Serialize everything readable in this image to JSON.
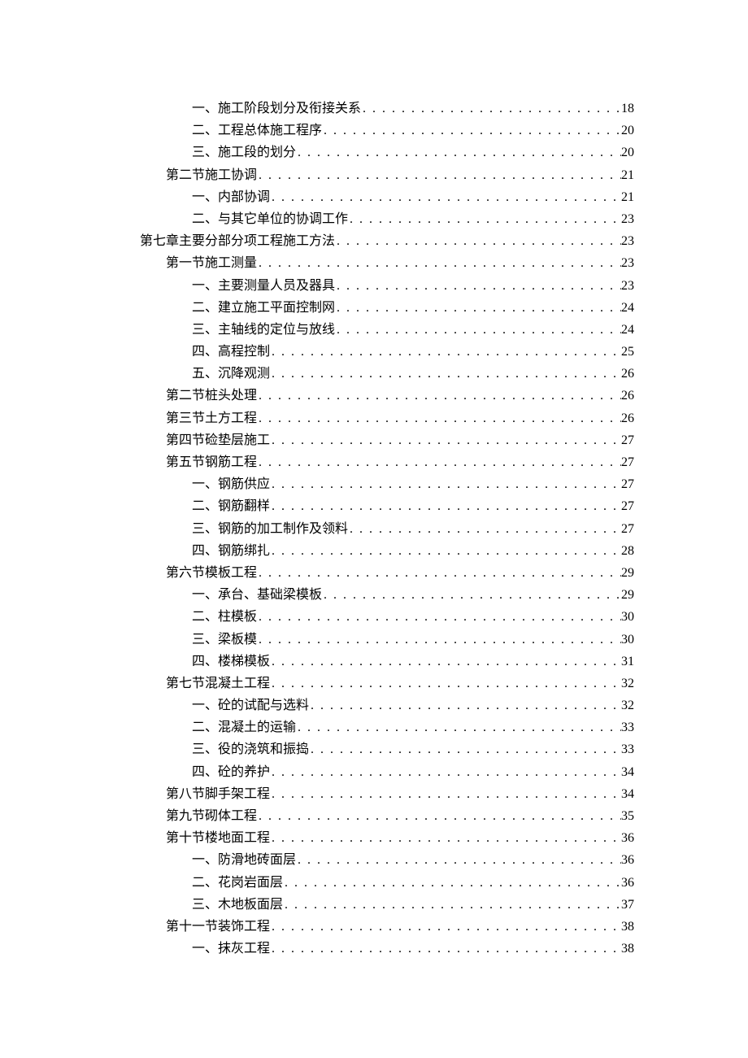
{
  "toc": [
    {
      "title": "一、施工阶段划分及衔接关系",
      "page": "18",
      "indent": 3
    },
    {
      "title": "二、工程总体施工程序",
      "page": "20",
      "indent": 3
    },
    {
      "title": "三、施工段的划分",
      "page": "20",
      "indent": 3
    },
    {
      "title": "第二节施工协调",
      "page": "21",
      "indent": 2
    },
    {
      "title": "一、内部协调",
      "page": "21",
      "indent": 3
    },
    {
      "title": "二、与其它单位的协调工作",
      "page": "23",
      "indent": 3
    },
    {
      "title": "第七章主要分部分项工程施工方法",
      "page": "23",
      "indent": 1
    },
    {
      "title": "第一节施工测量",
      "page": "23",
      "indent": 2
    },
    {
      "title": "一、主要测量人员及器具",
      "page": "23",
      "indent": 3
    },
    {
      "title": "二、建立施工平面控制网",
      "page": "24",
      "indent": 3
    },
    {
      "title": "三、主轴线的定位与放线",
      "page": "24",
      "indent": 3
    },
    {
      "title": "四、高程控制",
      "page": "25",
      "indent": 3
    },
    {
      "title": "五、沉降观测",
      "page": "26",
      "indent": 3
    },
    {
      "title": "第二节桩头处理",
      "page": "26",
      "indent": 2
    },
    {
      "title": "第三节土方工程",
      "page": "26",
      "indent": 2
    },
    {
      "title": "第四节硷垫层施工",
      "page": "27",
      "indent": 2
    },
    {
      "title": "第五节钢筋工程",
      "page": "27",
      "indent": 2
    },
    {
      "title": "一、钢筋供应",
      "page": "27",
      "indent": 3
    },
    {
      "title": "二、钢筋翻样",
      "page": "27",
      "indent": 3
    },
    {
      "title": "三、钢筋的加工制作及领料",
      "page": "27",
      "indent": 3
    },
    {
      "title": "四、钢筋绑扎",
      "page": "28",
      "indent": 3
    },
    {
      "title": "第六节模板工程",
      "page": "29",
      "indent": 2
    },
    {
      "title": "一、承台、基础梁模板",
      "page": "29",
      "indent": 3
    },
    {
      "title": "二、柱模板",
      "page": "30",
      "indent": 3
    },
    {
      "title": "三、梁板模",
      "page": "30",
      "indent": 3
    },
    {
      "title": "四、楼梯模板",
      "page": "31",
      "indent": 3
    },
    {
      "title": "第七节混凝土工程",
      "page": "32",
      "indent": 2
    },
    {
      "title": "一、砼的试配与选料",
      "page": "32",
      "indent": 3
    },
    {
      "title": "二、混凝土的运输",
      "page": "33",
      "indent": 3
    },
    {
      "title": "三、役的浇筑和振捣",
      "page": "33",
      "indent": 3
    },
    {
      "title": "四、砼的养护",
      "page": "34",
      "indent": 3
    },
    {
      "title": "第八节脚手架工程",
      "page": "34",
      "indent": 2
    },
    {
      "title": "第九节砌体工程",
      "page": "35",
      "indent": 2
    },
    {
      "title": "第十节楼地面工程",
      "page": "36",
      "indent": 2
    },
    {
      "title": "一、防滑地砖面层",
      "page": "36",
      "indent": 3
    },
    {
      "title": "二、花岗岩面层",
      "page": "36",
      "indent": 3
    },
    {
      "title": "三、木地板面层",
      "page": "37",
      "indent": 3
    },
    {
      "title": "第十一节装饰工程",
      "page": "38",
      "indent": 2
    },
    {
      "title": "一、抹灰工程",
      "page": "38",
      "indent": 3
    }
  ]
}
